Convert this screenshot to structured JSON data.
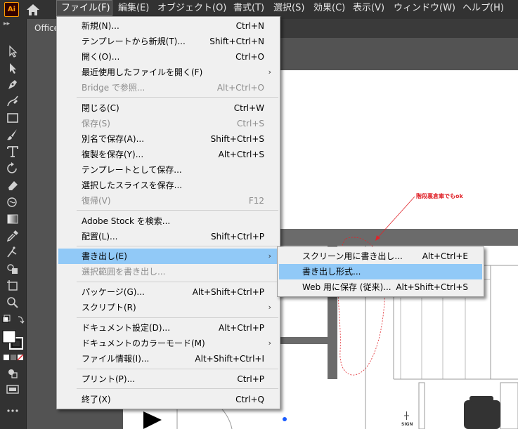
{
  "app": {
    "logo_text": "Ai",
    "document_tab": "Office"
  },
  "menubar": [
    {
      "label": "ファイル(F)",
      "active": true
    },
    {
      "label": "編集(E)"
    },
    {
      "label": "オブジェクト(O)"
    },
    {
      "label": "書式(T)"
    },
    {
      "label": "選択(S)"
    },
    {
      "label": "効果(C)"
    },
    {
      "label": "表示(V)"
    },
    {
      "label": "ウィンドウ(W)"
    },
    {
      "label": "ヘルプ(H)"
    }
  ],
  "file_menu": {
    "items": [
      {
        "label": "新規(N)...",
        "shortcut": "Ctrl+N"
      },
      {
        "label": "テンプレートから新規(T)...",
        "shortcut": "Shift+Ctrl+N"
      },
      {
        "label": "開く(O)...",
        "shortcut": "Ctrl+O"
      },
      {
        "label": "最近使用したファイルを開く(F)",
        "shortcut": "",
        "submenu": true
      },
      {
        "label": "Bridge で参照...",
        "shortcut": "Alt+Ctrl+O",
        "disabled": true
      },
      {
        "label": "閉じる(C)",
        "shortcut": "Ctrl+W"
      },
      {
        "label": "保存(S)",
        "shortcut": "Ctrl+S",
        "disabled": true
      },
      {
        "label": "別名で保存(A)...",
        "shortcut": "Shift+Ctrl+S"
      },
      {
        "label": "複製を保存(Y)...",
        "shortcut": "Alt+Ctrl+S"
      },
      {
        "label": "テンプレートとして保存...",
        "shortcut": ""
      },
      {
        "label": "選択したスライスを保存...",
        "shortcut": ""
      },
      {
        "label": "復帰(V)",
        "shortcut": "F12",
        "disabled": true
      },
      {
        "label": "Adobe Stock を検索...",
        "shortcut": ""
      },
      {
        "label": "配置(L)...",
        "shortcut": "Shift+Ctrl+P"
      },
      {
        "label": "書き出し(E)",
        "shortcut": "",
        "submenu": true,
        "highlighted": true
      },
      {
        "label": "選択範囲を書き出し...",
        "shortcut": "",
        "disabled": true
      },
      {
        "label": "パッケージ(G)...",
        "shortcut": "Alt+Shift+Ctrl+P"
      },
      {
        "label": "スクリプト(R)",
        "shortcut": "",
        "submenu": true
      },
      {
        "label": "ドキュメント設定(D)...",
        "shortcut": "Alt+Ctrl+P"
      },
      {
        "label": "ドキュメントのカラーモード(M)",
        "shortcut": "",
        "submenu": true
      },
      {
        "label": "ファイル情報(I)...",
        "shortcut": "Alt+Shift+Ctrl+I"
      },
      {
        "label": "プリント(P)...",
        "shortcut": "Ctrl+P"
      },
      {
        "label": "終了(X)",
        "shortcut": "Ctrl+Q"
      }
    ]
  },
  "export_submenu": {
    "items": [
      {
        "label": "スクリーン用に書き出し...",
        "shortcut": "Alt+Ctrl+E"
      },
      {
        "label": "書き出し形式...",
        "shortcut": "",
        "highlighted": true
      },
      {
        "label": "Web 用に保存 (従来)...",
        "shortcut": "Alt+Shift+Ctrl+S"
      }
    ]
  },
  "canvas": {
    "annotation": "階段裏倉庫でもok",
    "sign_label": "SIGN"
  },
  "icons": {
    "home": "home-icon",
    "tools": [
      "selection-tool-icon",
      "direct-selection-tool-icon",
      "pen-tool-icon",
      "curvature-tool-icon",
      "rectangle-tool-icon",
      "paintbrush-tool-icon",
      "type-tool-icon",
      "rotate-tool-icon",
      "eraser-tool-icon",
      "warp-tool-icon",
      "gradient-tool-icon",
      "eyedropper-tool-icon",
      "puppet-warp-tool-icon",
      "shape-builder-tool-icon",
      "artboard-tool-icon",
      "zoom-tool-icon"
    ]
  },
  "colors": {
    "menubar_bg": "#323232",
    "menu_bg": "#f0f0f0",
    "highlight": "#91c9f7",
    "accent_logo": "#ff9a00",
    "annotation": "#e0242a"
  }
}
